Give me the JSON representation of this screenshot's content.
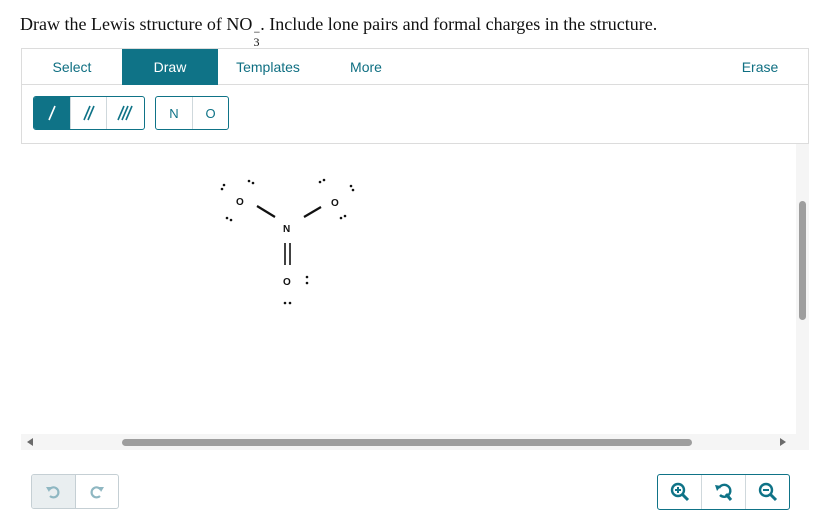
{
  "question": {
    "prefix": "Draw the Lewis structure of NO",
    "subscript": "3",
    "superscript": "−",
    "suffix": ". Include lone pairs and formal charges in the structure."
  },
  "tabs": [
    {
      "label": "Select"
    },
    {
      "label": "Draw"
    },
    {
      "label": "Templates"
    },
    {
      "label": "More"
    },
    {
      "label": "Erase"
    }
  ],
  "bond_tools": [
    "single-bond-icon",
    "double-bond-icon",
    "triple-bond-icon"
  ],
  "atom_tools": [
    "N",
    "O"
  ],
  "molecule": {
    "atoms": [
      "O",
      "N",
      "O",
      "O"
    ]
  },
  "history_controls": [
    "undo-icon",
    "redo-icon"
  ],
  "zoom_controls": [
    "zoom-in-icon",
    "zoom-reset-icon",
    "zoom-out-icon"
  ],
  "colors": {
    "accent": "#0f7387",
    "scrollbar": "#9e9e9e"
  }
}
